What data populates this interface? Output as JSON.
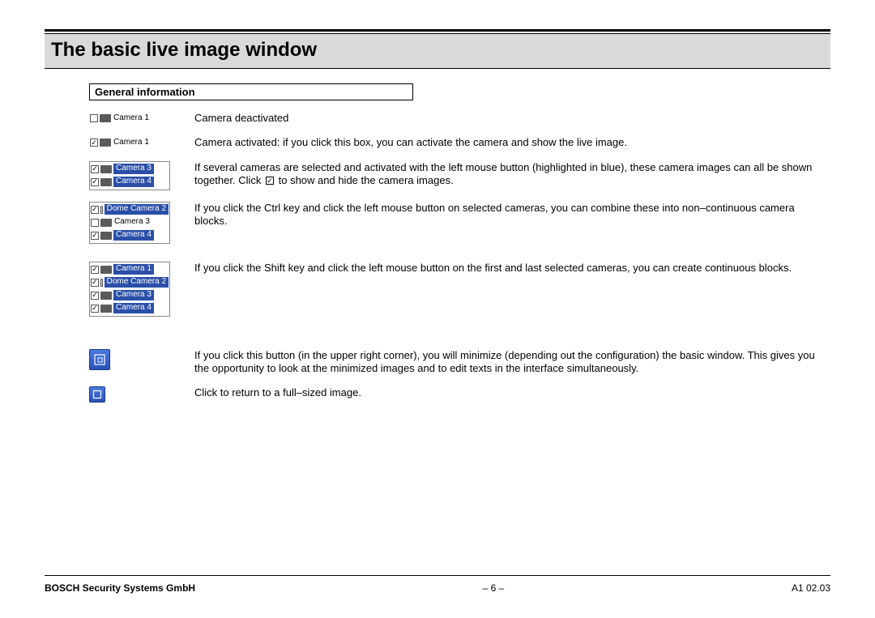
{
  "title": "The basic live image window",
  "section_header": "General information",
  "rows": {
    "r1": {
      "cam_label": "Camera 1",
      "text": "Camera deactivated"
    },
    "r2": {
      "cam_label": "Camera 1",
      "text": "Camera activated:  if you click this box, you can activate the camera and show the live image."
    },
    "r3": {
      "cam3": "Camera 3",
      "cam4": "Camera 4",
      "text_a": "If several cameras are selected and activated with the left mouse button (highlighted in blue), these camera images can all be shown together. Click ",
      "text_b": " to show and hide the camera images."
    },
    "r4": {
      "dome": "Dome Camera 2",
      "cam3": "Camera 3",
      "cam4": "Camera 4",
      "text": "If you click the Ctrl key and click the left mouse button on selected cameras, you can combine these into non–continuous camera blocks."
    },
    "r5": {
      "cam1": "Camera 1",
      "dome": "Dome Camera 2",
      "cam3": "Camera 3",
      "cam4": "Camera 4",
      "text": "If you click the Shift key and click the left mouse button on the first and last selected cameras, you can create continuous blocks."
    },
    "r6": {
      "text": "If you click this button (in the upper right corner), you will minimize (depending out the configuration)  the basic window. This gives you the opportunity to look at the minimized images and to edit texts in the interface simultaneously."
    },
    "r7": {
      "text": "Click to return to a full–sized image."
    }
  },
  "footer": {
    "left": "BOSCH Security Systems GmbH",
    "center": "–  6   –",
    "right": "A1 02.03"
  }
}
